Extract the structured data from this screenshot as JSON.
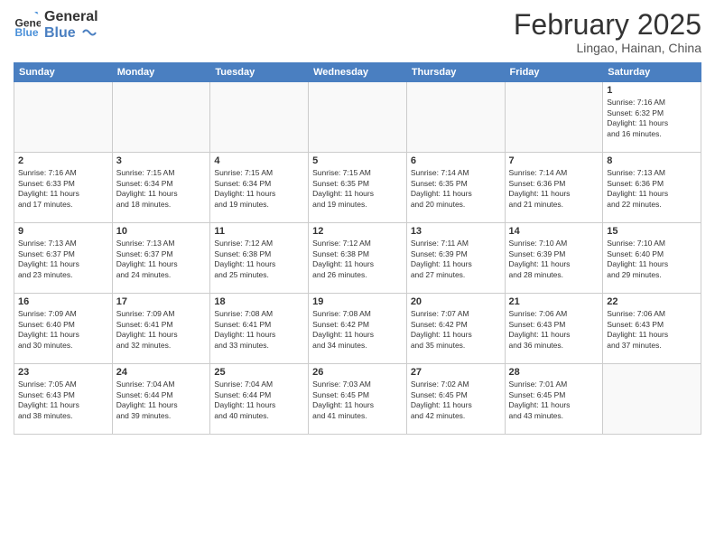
{
  "logo": {
    "line1": "General",
    "line2": "Blue"
  },
  "title": "February 2025",
  "subtitle": "Lingao, Hainan, China",
  "weekdays": [
    "Sunday",
    "Monday",
    "Tuesday",
    "Wednesday",
    "Thursday",
    "Friday",
    "Saturday"
  ],
  "weeks": [
    [
      {
        "day": "",
        "info": ""
      },
      {
        "day": "",
        "info": ""
      },
      {
        "day": "",
        "info": ""
      },
      {
        "day": "",
        "info": ""
      },
      {
        "day": "",
        "info": ""
      },
      {
        "day": "",
        "info": ""
      },
      {
        "day": "1",
        "info": "Sunrise: 7:16 AM\nSunset: 6:32 PM\nDaylight: 11 hours\nand 16 minutes."
      }
    ],
    [
      {
        "day": "2",
        "info": "Sunrise: 7:16 AM\nSunset: 6:33 PM\nDaylight: 11 hours\nand 17 minutes."
      },
      {
        "day": "3",
        "info": "Sunrise: 7:15 AM\nSunset: 6:34 PM\nDaylight: 11 hours\nand 18 minutes."
      },
      {
        "day": "4",
        "info": "Sunrise: 7:15 AM\nSunset: 6:34 PM\nDaylight: 11 hours\nand 19 minutes."
      },
      {
        "day": "5",
        "info": "Sunrise: 7:15 AM\nSunset: 6:35 PM\nDaylight: 11 hours\nand 19 minutes."
      },
      {
        "day": "6",
        "info": "Sunrise: 7:14 AM\nSunset: 6:35 PM\nDaylight: 11 hours\nand 20 minutes."
      },
      {
        "day": "7",
        "info": "Sunrise: 7:14 AM\nSunset: 6:36 PM\nDaylight: 11 hours\nand 21 minutes."
      },
      {
        "day": "8",
        "info": "Sunrise: 7:13 AM\nSunset: 6:36 PM\nDaylight: 11 hours\nand 22 minutes."
      }
    ],
    [
      {
        "day": "9",
        "info": "Sunrise: 7:13 AM\nSunset: 6:37 PM\nDaylight: 11 hours\nand 23 minutes."
      },
      {
        "day": "10",
        "info": "Sunrise: 7:13 AM\nSunset: 6:37 PM\nDaylight: 11 hours\nand 24 minutes."
      },
      {
        "day": "11",
        "info": "Sunrise: 7:12 AM\nSunset: 6:38 PM\nDaylight: 11 hours\nand 25 minutes."
      },
      {
        "day": "12",
        "info": "Sunrise: 7:12 AM\nSunset: 6:38 PM\nDaylight: 11 hours\nand 26 minutes."
      },
      {
        "day": "13",
        "info": "Sunrise: 7:11 AM\nSunset: 6:39 PM\nDaylight: 11 hours\nand 27 minutes."
      },
      {
        "day": "14",
        "info": "Sunrise: 7:10 AM\nSunset: 6:39 PM\nDaylight: 11 hours\nand 28 minutes."
      },
      {
        "day": "15",
        "info": "Sunrise: 7:10 AM\nSunset: 6:40 PM\nDaylight: 11 hours\nand 29 minutes."
      }
    ],
    [
      {
        "day": "16",
        "info": "Sunrise: 7:09 AM\nSunset: 6:40 PM\nDaylight: 11 hours\nand 30 minutes."
      },
      {
        "day": "17",
        "info": "Sunrise: 7:09 AM\nSunset: 6:41 PM\nDaylight: 11 hours\nand 32 minutes."
      },
      {
        "day": "18",
        "info": "Sunrise: 7:08 AM\nSunset: 6:41 PM\nDaylight: 11 hours\nand 33 minutes."
      },
      {
        "day": "19",
        "info": "Sunrise: 7:08 AM\nSunset: 6:42 PM\nDaylight: 11 hours\nand 34 minutes."
      },
      {
        "day": "20",
        "info": "Sunrise: 7:07 AM\nSunset: 6:42 PM\nDaylight: 11 hours\nand 35 minutes."
      },
      {
        "day": "21",
        "info": "Sunrise: 7:06 AM\nSunset: 6:43 PM\nDaylight: 11 hours\nand 36 minutes."
      },
      {
        "day": "22",
        "info": "Sunrise: 7:06 AM\nSunset: 6:43 PM\nDaylight: 11 hours\nand 37 minutes."
      }
    ],
    [
      {
        "day": "23",
        "info": "Sunrise: 7:05 AM\nSunset: 6:43 PM\nDaylight: 11 hours\nand 38 minutes."
      },
      {
        "day": "24",
        "info": "Sunrise: 7:04 AM\nSunset: 6:44 PM\nDaylight: 11 hours\nand 39 minutes."
      },
      {
        "day": "25",
        "info": "Sunrise: 7:04 AM\nSunset: 6:44 PM\nDaylight: 11 hours\nand 40 minutes."
      },
      {
        "day": "26",
        "info": "Sunrise: 7:03 AM\nSunset: 6:45 PM\nDaylight: 11 hours\nand 41 minutes."
      },
      {
        "day": "27",
        "info": "Sunrise: 7:02 AM\nSunset: 6:45 PM\nDaylight: 11 hours\nand 42 minutes."
      },
      {
        "day": "28",
        "info": "Sunrise: 7:01 AM\nSunset: 6:45 PM\nDaylight: 11 hours\nand 43 minutes."
      },
      {
        "day": "",
        "info": ""
      }
    ]
  ]
}
